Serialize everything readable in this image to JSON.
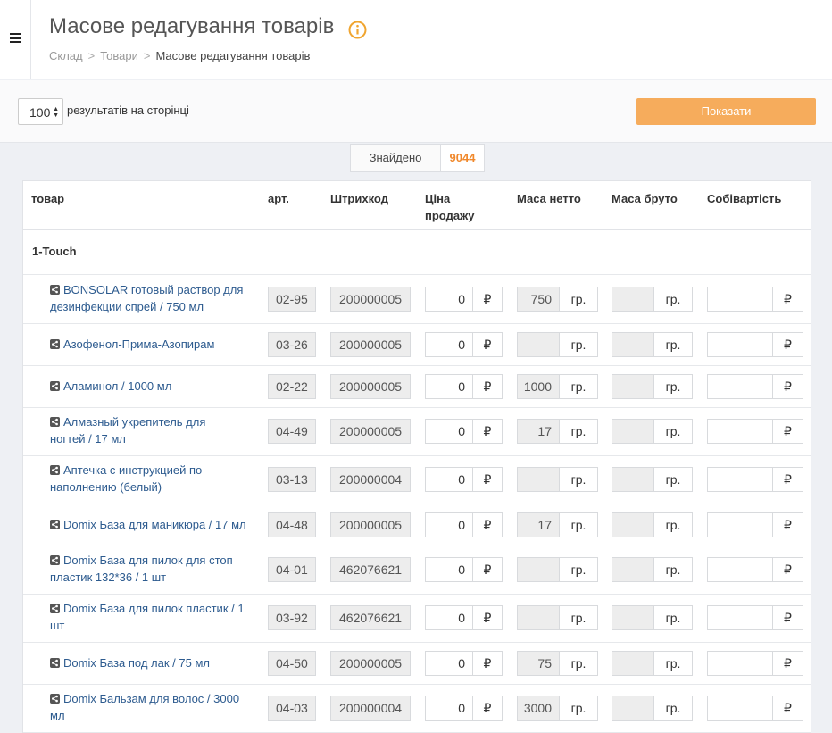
{
  "header": {
    "title": "Масове редагування товарів",
    "breadcrumb": [
      {
        "label": "Склад"
      },
      {
        "label": "Товари"
      },
      {
        "label": "Масове редагування товарів"
      }
    ],
    "separator": ">"
  },
  "toolbar": {
    "per_page_value": "100",
    "per_page_label": "результатів на сторінці",
    "show_button": "Показати"
  },
  "found": {
    "label": "Знайдено",
    "count": "9044"
  },
  "colors": {
    "accent": "#f6ac5c",
    "link": "#2d5b8f",
    "count": "#f0882b"
  },
  "table": {
    "headers": {
      "product": "товар",
      "article": "арт.",
      "barcode": "Штрихкод",
      "price_line1": "Ціна",
      "price_line2": "продажу",
      "net": "Маса нетто",
      "gross": "Маса бруто",
      "cost": "Собівартість"
    },
    "group": "1-Touch",
    "currency": "₽",
    "weight_unit": "гр.",
    "rows": [
      {
        "name1": "BONSOLAR готовый раствор для",
        "name2": "дезинфекции спрей / 750 мл",
        "art": "02-95",
        "barcode": "200000005",
        "price": "0",
        "net": "750",
        "gross": "",
        "cost": ""
      },
      {
        "name1": "Азофенол-Прима-Азопирам",
        "name2": "",
        "art": "03-26",
        "barcode": "200000005",
        "price": "0",
        "net": "",
        "gross": "",
        "cost": ""
      },
      {
        "name1": "Аламинол / 1000 мл",
        "name2": "",
        "art": "02-22",
        "barcode": "200000005",
        "price": "0",
        "net": "1000",
        "gross": "",
        "cost": ""
      },
      {
        "name1": "Алмазный укрепитель для",
        "name2": "ногтей / 17 мл",
        "art": "04-49",
        "barcode": "200000005",
        "price": "0",
        "net": "17",
        "gross": "",
        "cost": ""
      },
      {
        "name1": "Аптечка с инструкцией по",
        "name2": "наполнению (белый)",
        "art": "03-13",
        "barcode": "200000004",
        "price": "0",
        "net": "",
        "gross": "",
        "cost": ""
      },
      {
        "name1": "Domix База для маникюра / 17 мл",
        "name2": "",
        "art": "04-48",
        "barcode": "200000005",
        "price": "0",
        "net": "17",
        "gross": "",
        "cost": ""
      },
      {
        "name1": "Domix База для пилок для стоп",
        "name2": "пластик 132*36 / 1 шт",
        "art": "04-01",
        "barcode": "462076621",
        "price": "0",
        "net": "",
        "gross": "",
        "cost": ""
      },
      {
        "name1": "Domix База для пилок пластик / 1",
        "name2": "шт",
        "art": "03-92",
        "barcode": "462076621",
        "price": "0",
        "net": "",
        "gross": "",
        "cost": ""
      },
      {
        "name1": "Domix База под лак / 75 мл",
        "name2": "",
        "art": "04-50",
        "barcode": "200000005",
        "price": "0",
        "net": "75",
        "gross": "",
        "cost": ""
      },
      {
        "name1": "Domix Бальзам для волос / 3000",
        "name2": "мл",
        "art": "04-03",
        "barcode": "200000004",
        "price": "0",
        "net": "3000",
        "gross": "",
        "cost": ""
      }
    ]
  }
}
